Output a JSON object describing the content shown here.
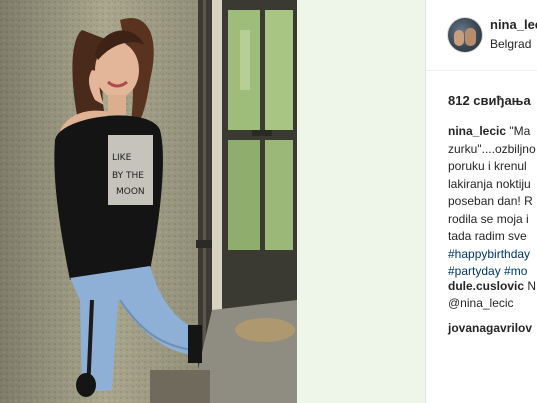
{
  "post": {
    "username": "nina_lecic",
    "location": "Belgrad",
    "likes": "812 свиђања"
  },
  "caption_lines": [
    {
      "user": "nina_lecic",
      "text": " \"Ma"
    },
    {
      "text": "zurku\"....ozbiljno"
    },
    {
      "text": "poruku i krenul"
    },
    {
      "text": "lakiranja noktiju"
    },
    {
      "text": "poseban dan! R"
    },
    {
      "text": "rodila se moja i"
    },
    {
      "text": "tada radim sve"
    },
    {
      "tag": "#happybirthday"
    },
    {
      "tag": "#partyday #mo"
    }
  ],
  "comments": [
    {
      "user": "dule.cuslovic",
      "text": " N",
      "mention": "@nina_lecic"
    },
    {
      "user": "jovanagavrilov",
      "text": ""
    }
  ],
  "image": {
    "alt_semantic": "post-photo",
    "colors": {
      "wall": "#a7a48b",
      "wall_dark": "#7e7a64",
      "door": "#3a3a33",
      "glass": "#8fb06a",
      "top": "#141414",
      "jeans": "#8fb0d6",
      "hair": "#4a2a1a",
      "skin": "#e3b69a"
    }
  }
}
